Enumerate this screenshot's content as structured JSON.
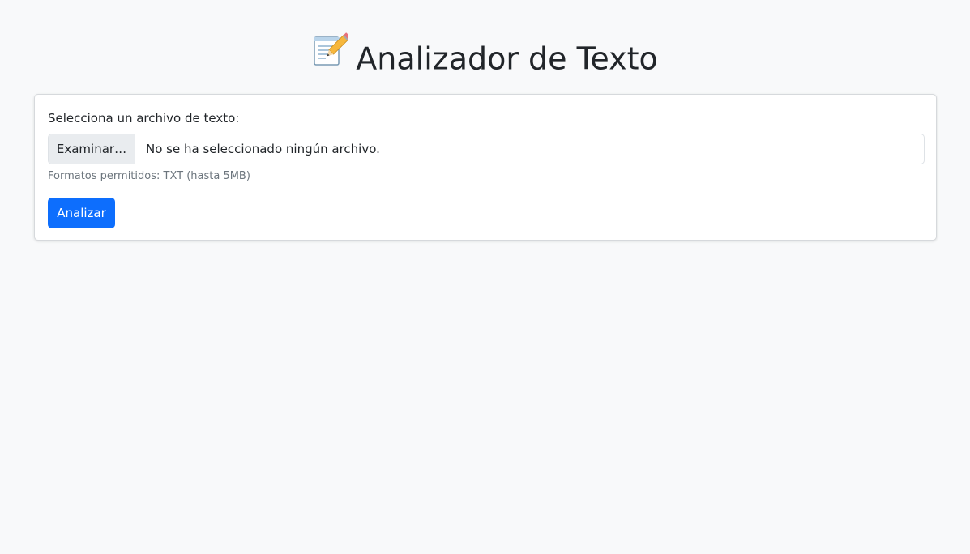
{
  "header": {
    "title": "Analizador de Texto",
    "icon": "memo-pencil-icon"
  },
  "form": {
    "label": "Selecciona un archivo de texto:",
    "file_input": {
      "browse_label": "Examinar…",
      "status_text": "No se ha seleccionado ningún archivo."
    },
    "help_text": "Formatos permitidos: TXT (hasta 5MB)",
    "submit_label": "Analizar"
  },
  "colors": {
    "background": "#f8f9fa",
    "card": "#ffffff",
    "primary": "#0d6efd",
    "muted": "#6c757d",
    "browse_bg": "#e9ecef"
  }
}
